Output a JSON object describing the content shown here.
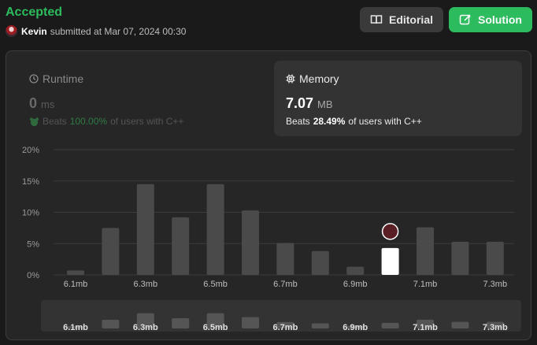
{
  "header": {
    "status": "Accepted",
    "user": "Kevin",
    "submitted_text": "submitted at Mar 07, 2024 00:30"
  },
  "buttons": {
    "editorial": "Editorial",
    "solution": "Solution"
  },
  "runtime": {
    "title": "Runtime",
    "value": "0",
    "unit": "ms",
    "beats_label": "Beats",
    "beats_pct": "100.00%",
    "beats_suffix": "of users with C++"
  },
  "memory": {
    "title": "Memory",
    "value": "7.07",
    "unit": "MB",
    "beats_label": "Beats",
    "beats_pct": "28.49%",
    "beats_suffix": "of users with C++"
  },
  "colors": {
    "accent_green": "#2cbb5d",
    "bar": "#4a4a4a",
    "bar_highlight": "#ffffff"
  },
  "chart_data": {
    "type": "bar",
    "ylabel_ticks": [
      "0%",
      "5%",
      "10%",
      "15%",
      "20%"
    ],
    "ylim": [
      0,
      20
    ],
    "x_tick_labels": [
      "6.1mb",
      "6.3mb",
      "6.5mb",
      "6.7mb",
      "6.9mb",
      "7.1mb",
      "7.3mb"
    ],
    "values": [
      0.7,
      7.5,
      14.5,
      9.2,
      14.5,
      10.3,
      5.1,
      3.8,
      1.3,
      4.3,
      7.6,
      5.3,
      5.3
    ],
    "highlight_index": 9,
    "grid": true
  }
}
